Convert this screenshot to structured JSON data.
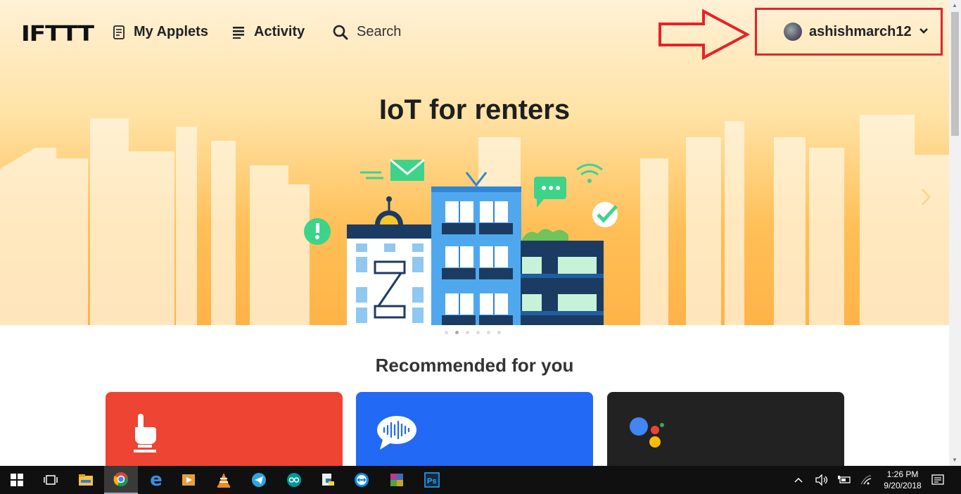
{
  "brand": {
    "logo": "IFTTT"
  },
  "nav": {
    "my_applets": "My Applets",
    "activity": "Activity",
    "search": "Search"
  },
  "user": {
    "username": "ashishmarch12"
  },
  "hero": {
    "title": "IoT for renters",
    "slides_total": 6,
    "active_slide": 2
  },
  "recommended": {
    "title": "Recommended for you",
    "cards": [
      {
        "color": "#ee4433",
        "icon": "button-press-icon"
      },
      {
        "color": "#2269f5",
        "icon": "voice-bubble-icon"
      },
      {
        "color": "#222222",
        "icon": "google-assistant-icon"
      }
    ]
  },
  "taskbar": {
    "apps": [
      "start-icon",
      "task-view-icon",
      "file-explorer-icon",
      "chrome-icon",
      "edge-icon",
      "media-player-icon",
      "vlc-icon",
      "telegram-icon",
      "arduino-icon",
      "python-icon",
      "teamviewer-icon",
      "winrar-icon",
      "photoshop-icon"
    ],
    "clock": {
      "time": "1:26 PM",
      "date": "9/20/2018"
    }
  },
  "colors": {
    "highlight": "#e8212a",
    "hero_orange": "#ffb347"
  }
}
